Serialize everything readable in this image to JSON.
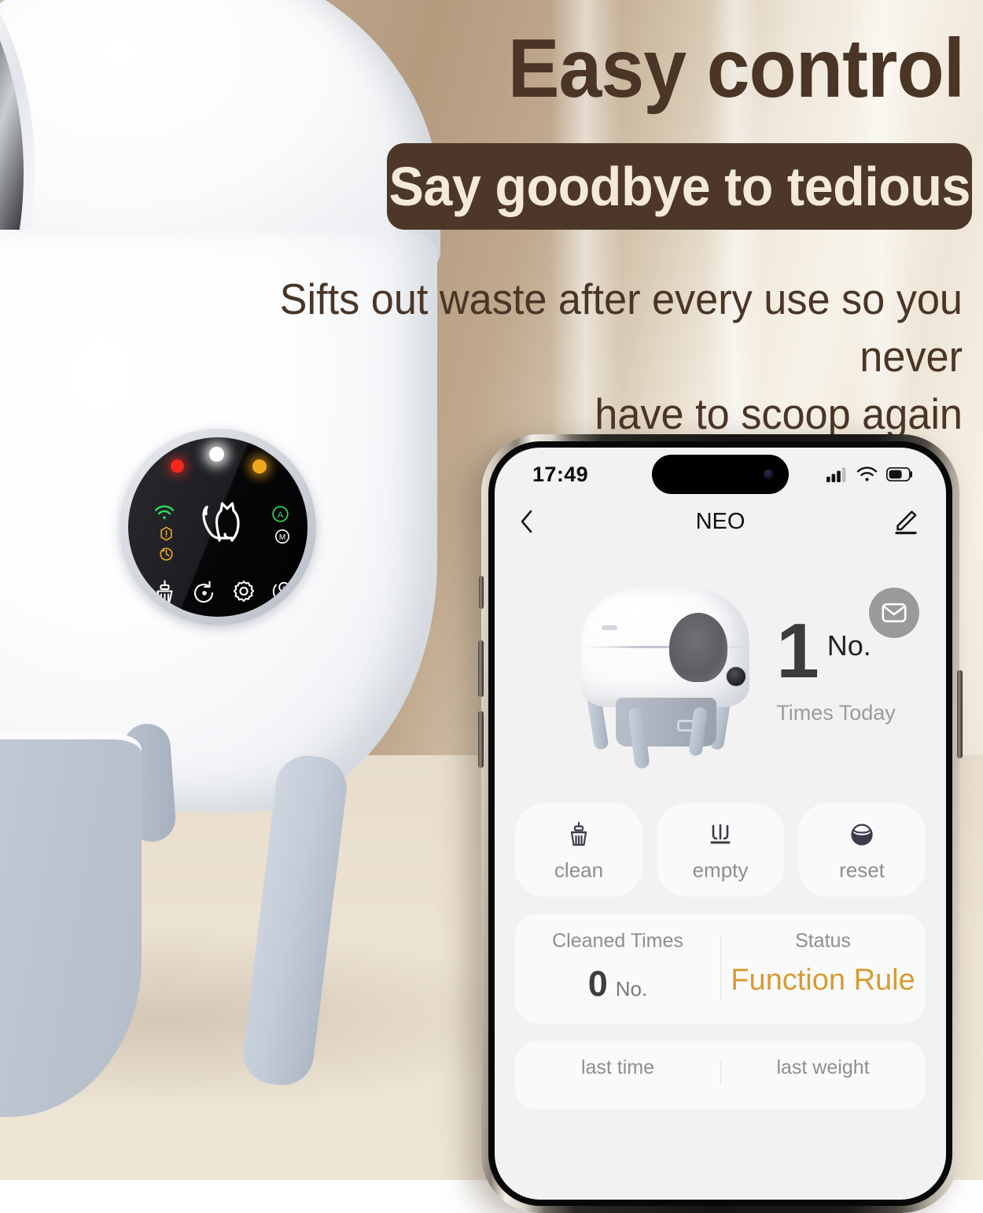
{
  "marketing": {
    "headline": "Easy control",
    "ribbon": "Say goodbye to tedious",
    "subhead_line1": "Sifts out waste after every use so you never",
    "subhead_line2": "have to scoop again",
    "headline_color": "#4a3527",
    "ribbon_bg": "#4c3728",
    "ribbon_text_color": "#f5ead7"
  },
  "device_panel": {
    "leds": [
      {
        "name": "red-indicator",
        "color": "#f2271f"
      },
      {
        "name": "white-indicator",
        "color": "#ffffff"
      },
      {
        "name": "amber-indicator",
        "color": "#f0a81c"
      }
    ],
    "status_icons": [
      {
        "name": "wifi-icon",
        "color": "#2ee05a"
      },
      {
        "name": "warning-icon",
        "color": "#e6a21e"
      },
      {
        "name": "rotate-icon",
        "color": "#e6a21e"
      }
    ],
    "mode_icons": [
      {
        "name": "auto-mode-icon",
        "label": "A",
        "color": "#2ee05a"
      },
      {
        "name": "manual-mode-icon",
        "label": "M",
        "color": "#ffffff"
      }
    ],
    "cat_icon": "cat-icon",
    "buttons": [
      {
        "name": "brush-button"
      },
      {
        "name": "undo-button"
      },
      {
        "name": "settings-gear-button"
      },
      {
        "name": "auto-manual-toggle-button"
      }
    ]
  },
  "phone": {
    "status_bar": {
      "time": "17:49",
      "icons": [
        "cellular-signal-icon",
        "wifi-icon",
        "battery-icon"
      ]
    },
    "nav": {
      "back_icon": "chevron-left-icon",
      "title": "NEO",
      "edit_icon": "pencil-edit-icon"
    },
    "mail_button": {
      "icon": "envelope-icon",
      "bg": "#9a9a9a"
    },
    "hero": {
      "device_image_name": "litter-box-product-image",
      "count": "1",
      "count_unit": "No.",
      "count_label": "Times Today"
    },
    "actions": [
      {
        "name": "clean-button",
        "icon": "brush-icon",
        "label": "clean"
      },
      {
        "name": "empty-button",
        "icon": "empty-icon",
        "label": "empty"
      },
      {
        "name": "reset-button",
        "icon": "reset-icon",
        "label": "reset"
      }
    ],
    "stat_cards": [
      {
        "name": "cleaned-times-status-card",
        "columns": [
          {
            "name": "cleaned-times",
            "title": "Cleaned Times",
            "value": "0",
            "unit": "No.",
            "accent": false
          },
          {
            "name": "status",
            "title": "Status",
            "value": "Function Rule",
            "unit": "",
            "accent": true
          }
        ]
      },
      {
        "name": "last-time-last-weight-card",
        "columns": [
          {
            "name": "last-time",
            "title": "last time",
            "value": "",
            "unit": "",
            "accent": false
          },
          {
            "name": "last-weight",
            "title": "last weight",
            "value": "",
            "unit": "",
            "accent": false
          }
        ]
      }
    ],
    "accent_color": "#d79b33",
    "screen_bg": "#f2f2f2",
    "card_bg": "#fafafa"
  }
}
